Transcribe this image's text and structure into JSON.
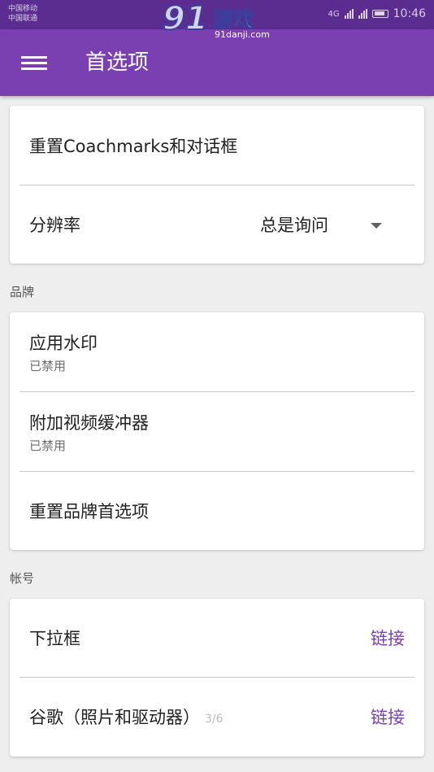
{
  "status_bar": {
    "carrier_1": "中国移动",
    "carrier_2": "中国联通",
    "network": "4G",
    "time": "10:46"
  },
  "watermark": {
    "logo_number": "91",
    "logo_text": "游戏",
    "url": "91danji.com"
  },
  "app_bar": {
    "title": "首选项"
  },
  "general": {
    "reset_coachmarks": "重置Coachmarks和对话框",
    "resolution_label": "分辨率",
    "resolution_value": "总是询问"
  },
  "branding": {
    "section_label": "品牌",
    "items": [
      {
        "title": "应用水印",
        "subtitle": "已禁用"
      },
      {
        "title": "附加视频缓冲器",
        "subtitle": "已禁用"
      },
      {
        "title": "重置品牌首选项"
      }
    ]
  },
  "account": {
    "section_label": "帐号",
    "items": [
      {
        "title": "下拉框",
        "action": "链接"
      },
      {
        "title": "谷歌（照片和驱动器）",
        "action": "链接"
      }
    ]
  },
  "page_indicator": "3/6",
  "colors": {
    "status_bar": "#5c2d91",
    "app_bar": "#7a3fb0",
    "accent": "#7a3fb0",
    "background": "#eeeeee"
  }
}
